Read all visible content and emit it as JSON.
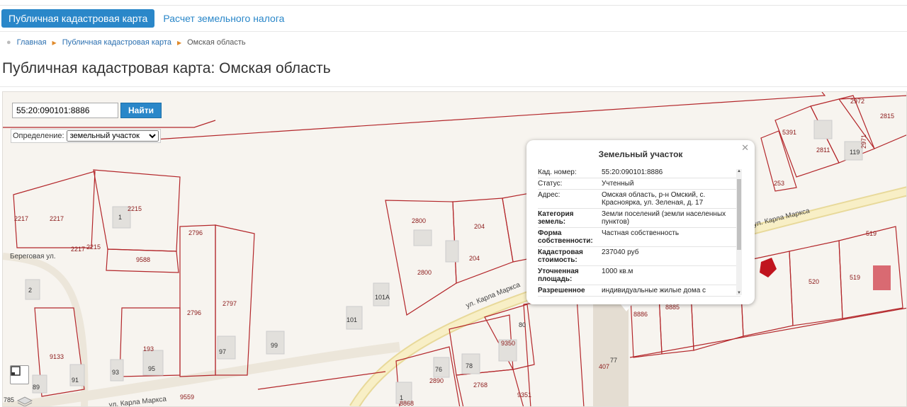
{
  "tabs": {
    "active": "Публичная кадастровая карта",
    "other": "Расчет земельного налога"
  },
  "breadcrumb": {
    "home": "Главная",
    "map": "Публичная кадастровая карта",
    "current": "Омская область"
  },
  "page_title": "Публичная кадастровая карта: Омская область",
  "search": {
    "value": "55:20:090101:8886",
    "button": "Найти"
  },
  "definition": {
    "label": "Определение:",
    "selected": "земельный участок"
  },
  "popup": {
    "title": "Земельный участок",
    "rows": [
      {
        "k": "Кад. номер:",
        "v": "55:20:090101:8886"
      },
      {
        "k": "Статус:",
        "v": "Учтенный"
      },
      {
        "k": "Адрес:",
        "v": "Омская область, р-н Омский, с. Красноярка, ул. Зеленая, д. 17"
      },
      {
        "k": "Категория земель:",
        "v": "Земли поселений (земли населенных пунктов)"
      },
      {
        "k": "Форма собственности:",
        "v": "Частная собственность"
      },
      {
        "k": "Кадастровая стоимость:",
        "v": "237040 руб"
      },
      {
        "k": "Уточненная площадь:",
        "v": "1000 кв.м"
      },
      {
        "k": "Разрешенное",
        "v": "индивидуальные жилые дома с"
      }
    ]
  },
  "map_labels": {
    "streets": [
      "Береговая ул.",
      "ул. Карла Маркса",
      "ул. Карла Маркса",
      "ул. Карла Маркса"
    ],
    "parcels": [
      "2217",
      "2217",
      "2215",
      "2217",
      "2215",
      "9588",
      "2796",
      "2796",
      "2797",
      "2800",
      "2800",
      "204",
      "204",
      "101А",
      "101",
      "97",
      "99",
      "193",
      "95",
      "93",
      "9133",
      "91",
      "89",
      "9559",
      "2890",
      "76",
      "78",
      "2768",
      "9350",
      "80",
      "8868",
      "9351",
      "8886",
      "8885",
      "407",
      "77",
      "5391",
      "2811",
      "119",
      "2971",
      "2972",
      "2815",
      "253",
      "520",
      "519",
      "519",
      "1",
      "1",
      "2",
      "785"
    ]
  },
  "colors": {
    "accent": "#2a87c9",
    "parcel": "#b3262a",
    "road": "#f3e3a1"
  }
}
